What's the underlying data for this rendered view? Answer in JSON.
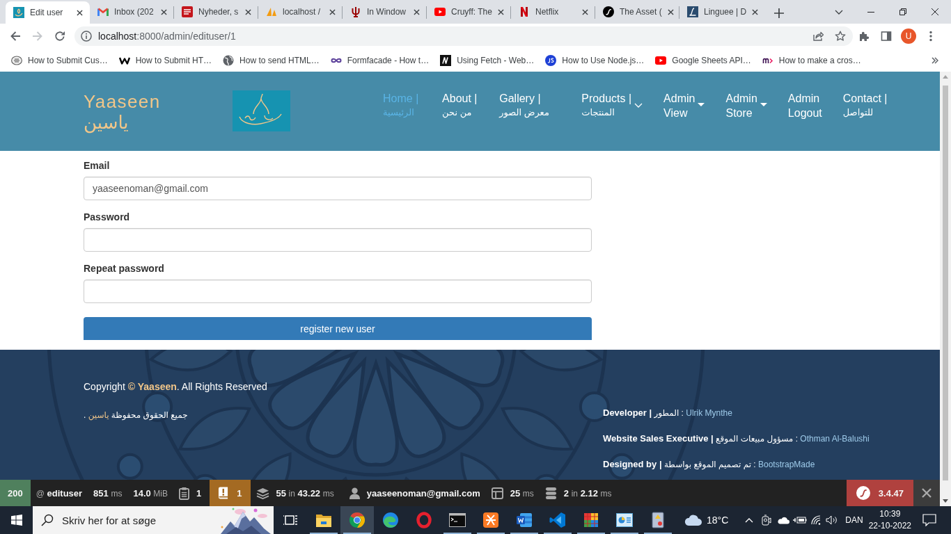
{
  "browser": {
    "tabs": [
      {
        "title": "Edit user",
        "selected": true,
        "kind": "site"
      },
      {
        "title": "Inbox (202",
        "selected": false,
        "kind": "mail"
      },
      {
        "title": "Nyheder, s",
        "selected": false,
        "kind": "news"
      },
      {
        "title": "localhost /",
        "selected": false,
        "kind": "sail"
      },
      {
        "title": "In Window",
        "selected": false,
        "kind": "trident"
      },
      {
        "title": "Cruyff: The",
        "selected": false,
        "kind": "play"
      },
      {
        "title": "Netflix",
        "selected": false,
        "kind": "n-logo"
      },
      {
        "title": "The Asset (",
        "selected": false,
        "kind": "circle-logo"
      },
      {
        "title": "Linguee | D",
        "selected": false,
        "kind": "square-logo"
      }
    ],
    "nav_buttons": [
      {
        "kind": "back",
        "disabled": false
      },
      {
        "kind": "forward",
        "disabled": true
      },
      {
        "kind": "reload",
        "disabled": false
      }
    ],
    "url": {
      "host": "localhost",
      "path": ":8000/admin/edituser/1"
    },
    "profile": {
      "initial": "U"
    },
    "bookmarks": [
      {
        "title": "How to Submit Cus…",
        "kind": "badge"
      },
      {
        "title": "How to Submit HT…",
        "kind": "zigzag"
      },
      {
        "title": "How to send HTML…",
        "kind": "globe"
      },
      {
        "title": "Formfacade - How t…",
        "kind": "infinity"
      },
      {
        "title": "Using Fetch - Web…",
        "kind": "square-logo"
      },
      {
        "title": "How to Use Node.js…",
        "kind": "circle-logo"
      },
      {
        "title": "Google Sheets API…",
        "kind": "play"
      },
      {
        "title": "How to make a cros…",
        "kind": "arc-logo"
      }
    ]
  },
  "site": {
    "brand": {
      "name": "Yaaseen",
      "name_ar": "ياسين"
    },
    "nav": [
      {
        "label": "Home |\nالرئيسية",
        "selected": true,
        "kind": "bilingual-link"
      },
      {
        "label": "About |\nمن نحن",
        "selected": false,
        "kind": "bilingual-link"
      },
      {
        "label": "Gallery |\nمعرض الصور",
        "selected": false,
        "kind": "bilingual-link"
      },
      {
        "label": "Products |\nالمنتجات",
        "selected": false,
        "kind": "bilingual-menu"
      },
      {
        "label": "Admin View",
        "selected": false,
        "kind": "menu"
      },
      {
        "label": "Admin Store",
        "selected": false,
        "kind": "menu"
      },
      {
        "label": "Admin Logout",
        "selected": false,
        "kind": "link"
      },
      {
        "label": "Contact |\nللتواصل",
        "selected": false,
        "kind": "bilingual-link"
      }
    ]
  },
  "form": {
    "fields": [
      {
        "label": "Email",
        "value": "yaaseenoman@gmail.com",
        "kind": "email"
      },
      {
        "label": "Password",
        "kind": "password"
      },
      {
        "label": "Repeat password",
        "kind": "password"
      }
    ],
    "submit": "register new user"
  },
  "footer": {
    "copyright": {
      "before": "Copyright ",
      "brand": "© Yaaseen",
      "after": ". All Rights Reserved"
    },
    "copyright_ar": {
      "before": "جميع الحقوق محفوظة ",
      "brand": "ياسين",
      "after": " ."
    },
    "credits": [
      {
        "role": "Developer |",
        "role_ar": "المطور :",
        "name": "Ulrik Mynthe"
      },
      {
        "role": "Website Sales Executive |",
        "role_ar": "مسؤول مبيعات الموقع :",
        "name": "Othman Al-Balushi"
      },
      {
        "role": "Designed by |",
        "role_ar": "تم تصميم الموقع بواسطة :",
        "name": "BootstrapMade"
      }
    ]
  },
  "profiler": {
    "items": [
      {
        "kind": "status",
        "parts": [
          {
            "text": "200",
            "kind": "value"
          }
        ]
      },
      {
        "kind": "route",
        "parts": [
          {
            "text": "@",
            "kind": "unit"
          },
          {
            "text": "edituser",
            "kind": "value"
          }
        ]
      },
      {
        "kind": "time",
        "parts": [
          {
            "text": "851",
            "kind": "value"
          },
          {
            "text": "ms",
            "kind": "unit"
          }
        ]
      },
      {
        "kind": "memory",
        "parts": [
          {
            "text": "14.0",
            "kind": "value"
          },
          {
            "text": "MiB",
            "kind": "unit"
          }
        ]
      },
      {
        "kind": "logs",
        "parts": [
          {
            "text": "1",
            "kind": "value"
          }
        ]
      },
      {
        "kind": "warnings",
        "parts": [
          {
            "text": "1",
            "kind": "value"
          }
        ]
      },
      {
        "kind": "cache",
        "parts": [
          {
            "text": "55",
            "kind": "value"
          },
          {
            "text": "in",
            "kind": "unit"
          },
          {
            "text": "43.22",
            "kind": "value"
          },
          {
            "text": "ms",
            "kind": "unit"
          }
        ]
      },
      {
        "kind": "user",
        "parts": [
          {
            "text": "yaaseenoman@gmail.com",
            "kind": "value"
          }
        ]
      },
      {
        "kind": "twig",
        "parts": [
          {
            "text": "25",
            "kind": "value"
          },
          {
            "text": "ms",
            "kind": "unit"
          }
        ]
      },
      {
        "kind": "database",
        "parts": [
          {
            "text": "2",
            "kind": "value"
          },
          {
            "text": "in",
            "kind": "unit"
          },
          {
            "text": "2.12",
            "kind": "value"
          },
          {
            "text": "ms",
            "kind": "unit"
          }
        ]
      }
    ],
    "version": "3.4.47"
  },
  "taskbar": {
    "search": {
      "placeholder": "Skriv her for at søge"
    },
    "apps": [
      {
        "kind": "task-view",
        "running": false,
        "selected": false
      },
      {
        "kind": "folder",
        "running": true,
        "selected": false
      },
      {
        "kind": "tricolor",
        "running": true,
        "selected": true
      },
      {
        "kind": "swirl",
        "running": false,
        "selected": false
      },
      {
        "kind": "ring",
        "running": false,
        "selected": false
      },
      {
        "kind": "terminal",
        "running": true,
        "selected": false
      },
      {
        "kind": "knot",
        "running": true,
        "selected": false
      },
      {
        "kind": "document",
        "running": true,
        "selected": false
      },
      {
        "kind": "ribbon",
        "running": true,
        "selected": false
      },
      {
        "kind": "tiles",
        "running": true,
        "selected": false
      },
      {
        "kind": "chart-window",
        "running": true,
        "selected": false
      },
      {
        "kind": "notebook",
        "running": true,
        "selected": false
      }
    ],
    "weather": "18°C",
    "language": "DAN",
    "time": "10:39",
    "date": "22-10-2022"
  }
}
